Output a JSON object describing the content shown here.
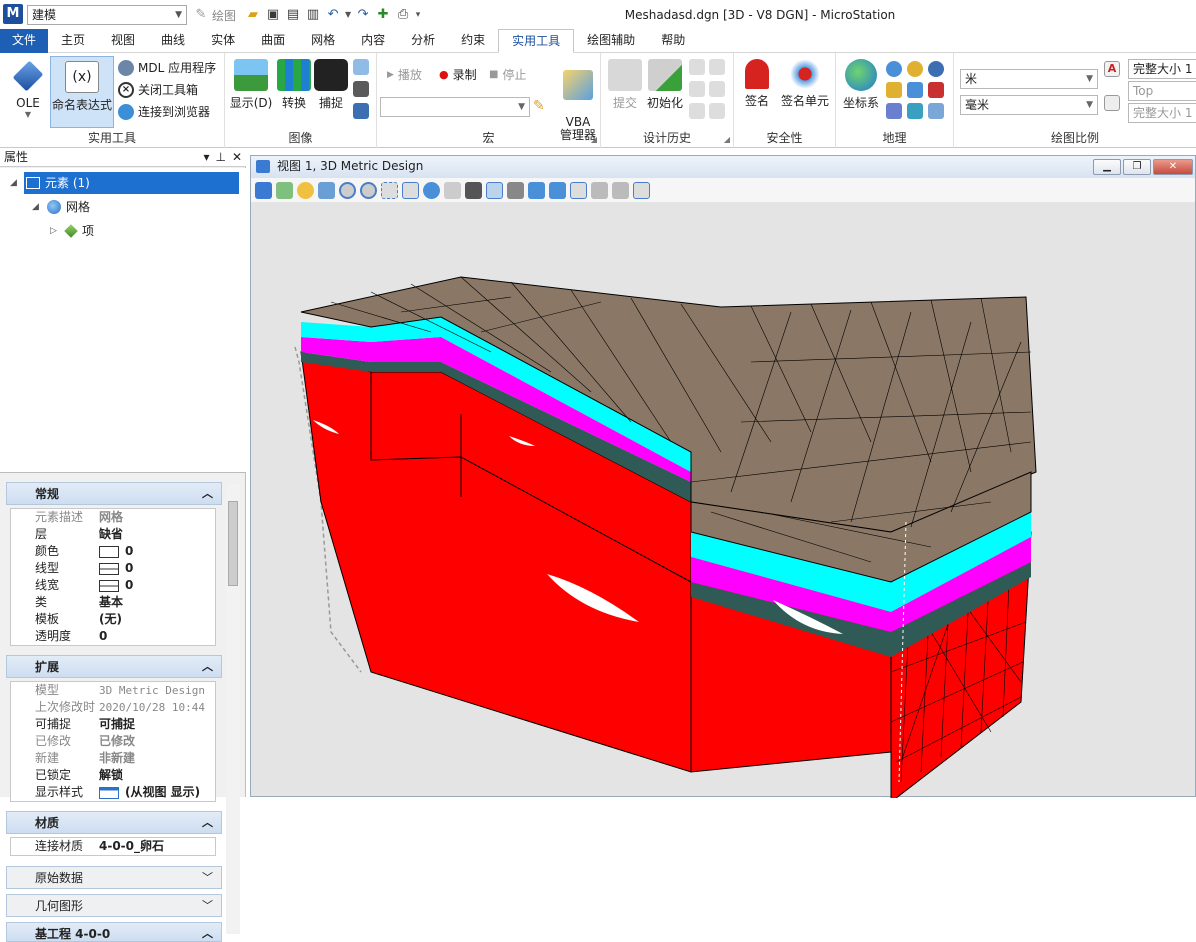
{
  "app": {
    "workflow": "建模",
    "draw_label": "绘图",
    "window_title": "Meshadasd.dgn [3D - V8 DGN] - MicroStation"
  },
  "menu": {
    "tabs": [
      "文件",
      "主页",
      "视图",
      "曲线",
      "实体",
      "曲面",
      "网格",
      "内容",
      "分析",
      "约束",
      "实用工具",
      "绘图辅助",
      "帮助"
    ],
    "active": "实用工具"
  },
  "ribbon": {
    "utilities": {
      "title": "实用工具",
      "ole": "OLE",
      "named_expr": "命名表达式",
      "mdl": "MDL 应用程序",
      "close_toolbox": "关闭工具箱",
      "connect_browser": "连接到浏览器"
    },
    "image": {
      "title": "图像",
      "display": "显示(D)",
      "convert": "转换",
      "capture": "捕捉"
    },
    "macro": {
      "title": "宏",
      "play": "播放",
      "record": "录制",
      "stop": "停止",
      "vba": "VBA\n管理器"
    },
    "history": {
      "title": "设计历史",
      "commit": "提交",
      "init": "初始化"
    },
    "security": {
      "title": "安全性",
      "sign": "签名",
      "sign_cell": "签名单元"
    },
    "geo": {
      "title": "地理",
      "coord": "坐标系"
    },
    "scale": {
      "title": "绘图比例",
      "unit1": "米",
      "unit2": "毫米",
      "size1": "完整大小 1",
      "top": "Top",
      "size2": "完整大小 1"
    }
  },
  "panel": {
    "title": "属性",
    "tree": {
      "root": "元素 (1)",
      "mesh": "网格",
      "item": "项"
    },
    "general": {
      "title": "常规",
      "rows": [
        {
          "label": "元素描述",
          "value": "网格",
          "dim": true
        },
        {
          "label": "层",
          "value": "缺省"
        },
        {
          "label": "颜色",
          "value": "0"
        },
        {
          "label": "线型",
          "value": "0"
        },
        {
          "label": "线宽",
          "value": "0"
        },
        {
          "label": "类",
          "value": "基本"
        },
        {
          "label": "模板",
          "value": "(无)"
        },
        {
          "label": "透明度",
          "value": "0"
        }
      ]
    },
    "extended": {
      "title": "扩展",
      "rows": [
        {
          "label": "模型",
          "value": "3D Metric Design",
          "dim": true
        },
        {
          "label": "上次修改时",
          "value": "2020/10/28 10:44",
          "dim": true
        },
        {
          "label": "可捕捉",
          "value": "可捕捉"
        },
        {
          "label": "已修改",
          "value": "已修改",
          "dim": true
        },
        {
          "label": "新建",
          "value": "非新建",
          "dim": true
        },
        {
          "label": "已锁定",
          "value": "解锁"
        },
        {
          "label": "显示样式",
          "value": "(从视图 显示)"
        }
      ]
    },
    "material": {
      "title": "材质",
      "label": "连接材质",
      "value": "4-0-0_卵石"
    },
    "raw_data": "原始数据",
    "geometry": "几何图形",
    "project": "基工程 4-0-0"
  },
  "view": {
    "title": "视图 1, 3D Metric Design"
  },
  "colors": {
    "accent": "#1d5fb4",
    "ground": "#8a7765",
    "cyan": "#00ffff",
    "magenta": "#ff00ff",
    "slate": "#2f5a55",
    "red": "#ff0000"
  }
}
